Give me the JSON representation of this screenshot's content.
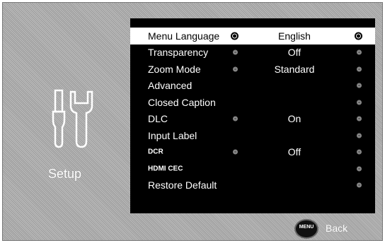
{
  "sidebar": {
    "icon": "tools-icon",
    "label": "Setup"
  },
  "menu": {
    "items": [
      {
        "label": "Menu Language",
        "value": "English",
        "selected": true,
        "left_dot": true,
        "small": false
      },
      {
        "label": "Transparency",
        "value": "Off",
        "selected": false,
        "left_dot": true,
        "small": false
      },
      {
        "label": "Zoom Mode",
        "value": "Standard",
        "selected": false,
        "left_dot": true,
        "small": false
      },
      {
        "label": "Advanced",
        "value": "",
        "selected": false,
        "left_dot": false,
        "small": false
      },
      {
        "label": "Closed Caption",
        "value": "",
        "selected": false,
        "left_dot": false,
        "small": false
      },
      {
        "label": "DLC",
        "value": "On",
        "selected": false,
        "left_dot": true,
        "small": false
      },
      {
        "label": "Input Label",
        "value": "",
        "selected": false,
        "left_dot": false,
        "small": false
      },
      {
        "label": "DCR",
        "value": "Off",
        "selected": false,
        "left_dot": true,
        "small": true
      },
      {
        "label": "HDMI CEC",
        "value": "",
        "selected": false,
        "left_dot": false,
        "small": true
      },
      {
        "label": "Restore Default",
        "value": "",
        "selected": false,
        "left_dot": false,
        "small": false
      }
    ]
  },
  "footer": {
    "menu_button_label": "MENU",
    "back_label": "Back"
  },
  "colors": {
    "panel": "#000000",
    "selected_row": "#ffffff",
    "background": "#b9b9b9"
  }
}
